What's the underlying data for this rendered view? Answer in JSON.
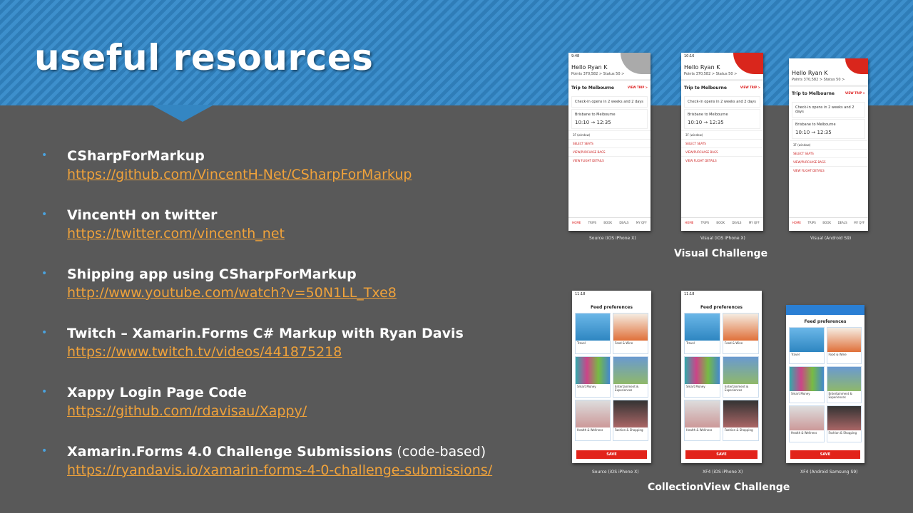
{
  "title": "useful resources",
  "items": [
    {
      "title": "CSharpForMarkup",
      "suffix": "",
      "link": "https://github.com/VincentH-Net/CSharpForMarkup"
    },
    {
      "title": "VincentH on twitter",
      "suffix": "",
      "link": "https://twitter.com/vincenth_net"
    },
    {
      "title": "Shipping app using CSharpForMarkup",
      "suffix": "",
      "link": "http://www.youtube.com/watch?v=50N1LL_Txe8"
    },
    {
      "title": "Twitch – Xamarin.Forms C# Markup with Ryan Davis",
      "suffix": "",
      "link": "https://www.twitch.tv/videos/441875218"
    },
    {
      "title": "Xappy Login Page Code",
      "suffix": "",
      "link": "https://github.com/rdavisau/Xappy/"
    },
    {
      "title": "Xamarin.Forms 4.0 Challenge Submissions",
      "suffix": " (code-based)",
      "link": "https://ryandavis.io/xamarin-forms-4-0-challenge-submissions/"
    }
  ],
  "visual": {
    "label": "Visual Challenge",
    "captions": [
      "Source (iOS iPhone X)",
      "Visual (iOS iPhone X)",
      "Visual (Android S9)"
    ],
    "times": [
      "9:48",
      "10:16",
      ""
    ],
    "hello": "Hello Ryan K",
    "points": "Points 370,582 >   Status 50 >",
    "trip": "Trip to Melbourne",
    "view_trip": "VIEW TRIP >",
    "checkin": "Check-in opens in 2 weeks and 2 days",
    "route": "Brisbane to Melbourne",
    "times_row": "10:10  →  12:35",
    "seat": "3F (window)",
    "rows": [
      "SELECT SEATS",
      "VIEW/PURCHASE BAGS",
      "VIEW FLIGHT DETAILS"
    ],
    "tabs": [
      "HOME",
      "TRIPS",
      "BOOK",
      "DEALS",
      "MY QFF"
    ]
  },
  "collection": {
    "label": "CollectionView Challenge",
    "captions": [
      "Source (iOS iPhone X)",
      "XF4 (iOS iPhone X)",
      "XF4 (Android Samsung S9)"
    ],
    "times": [
      "11:18",
      "11:18",
      ""
    ],
    "title": "Feed preferences",
    "tiles": [
      "Travel",
      "Food & Wine",
      "Smart Money",
      "Entertainment & Experiences",
      "Health & Wellness",
      "Fashion & Shopping"
    ],
    "save": "SAVE"
  },
  "colors": {
    "accent": "#f0a23a",
    "bullet": "#4aa3df",
    "red": "#e2231a"
  }
}
